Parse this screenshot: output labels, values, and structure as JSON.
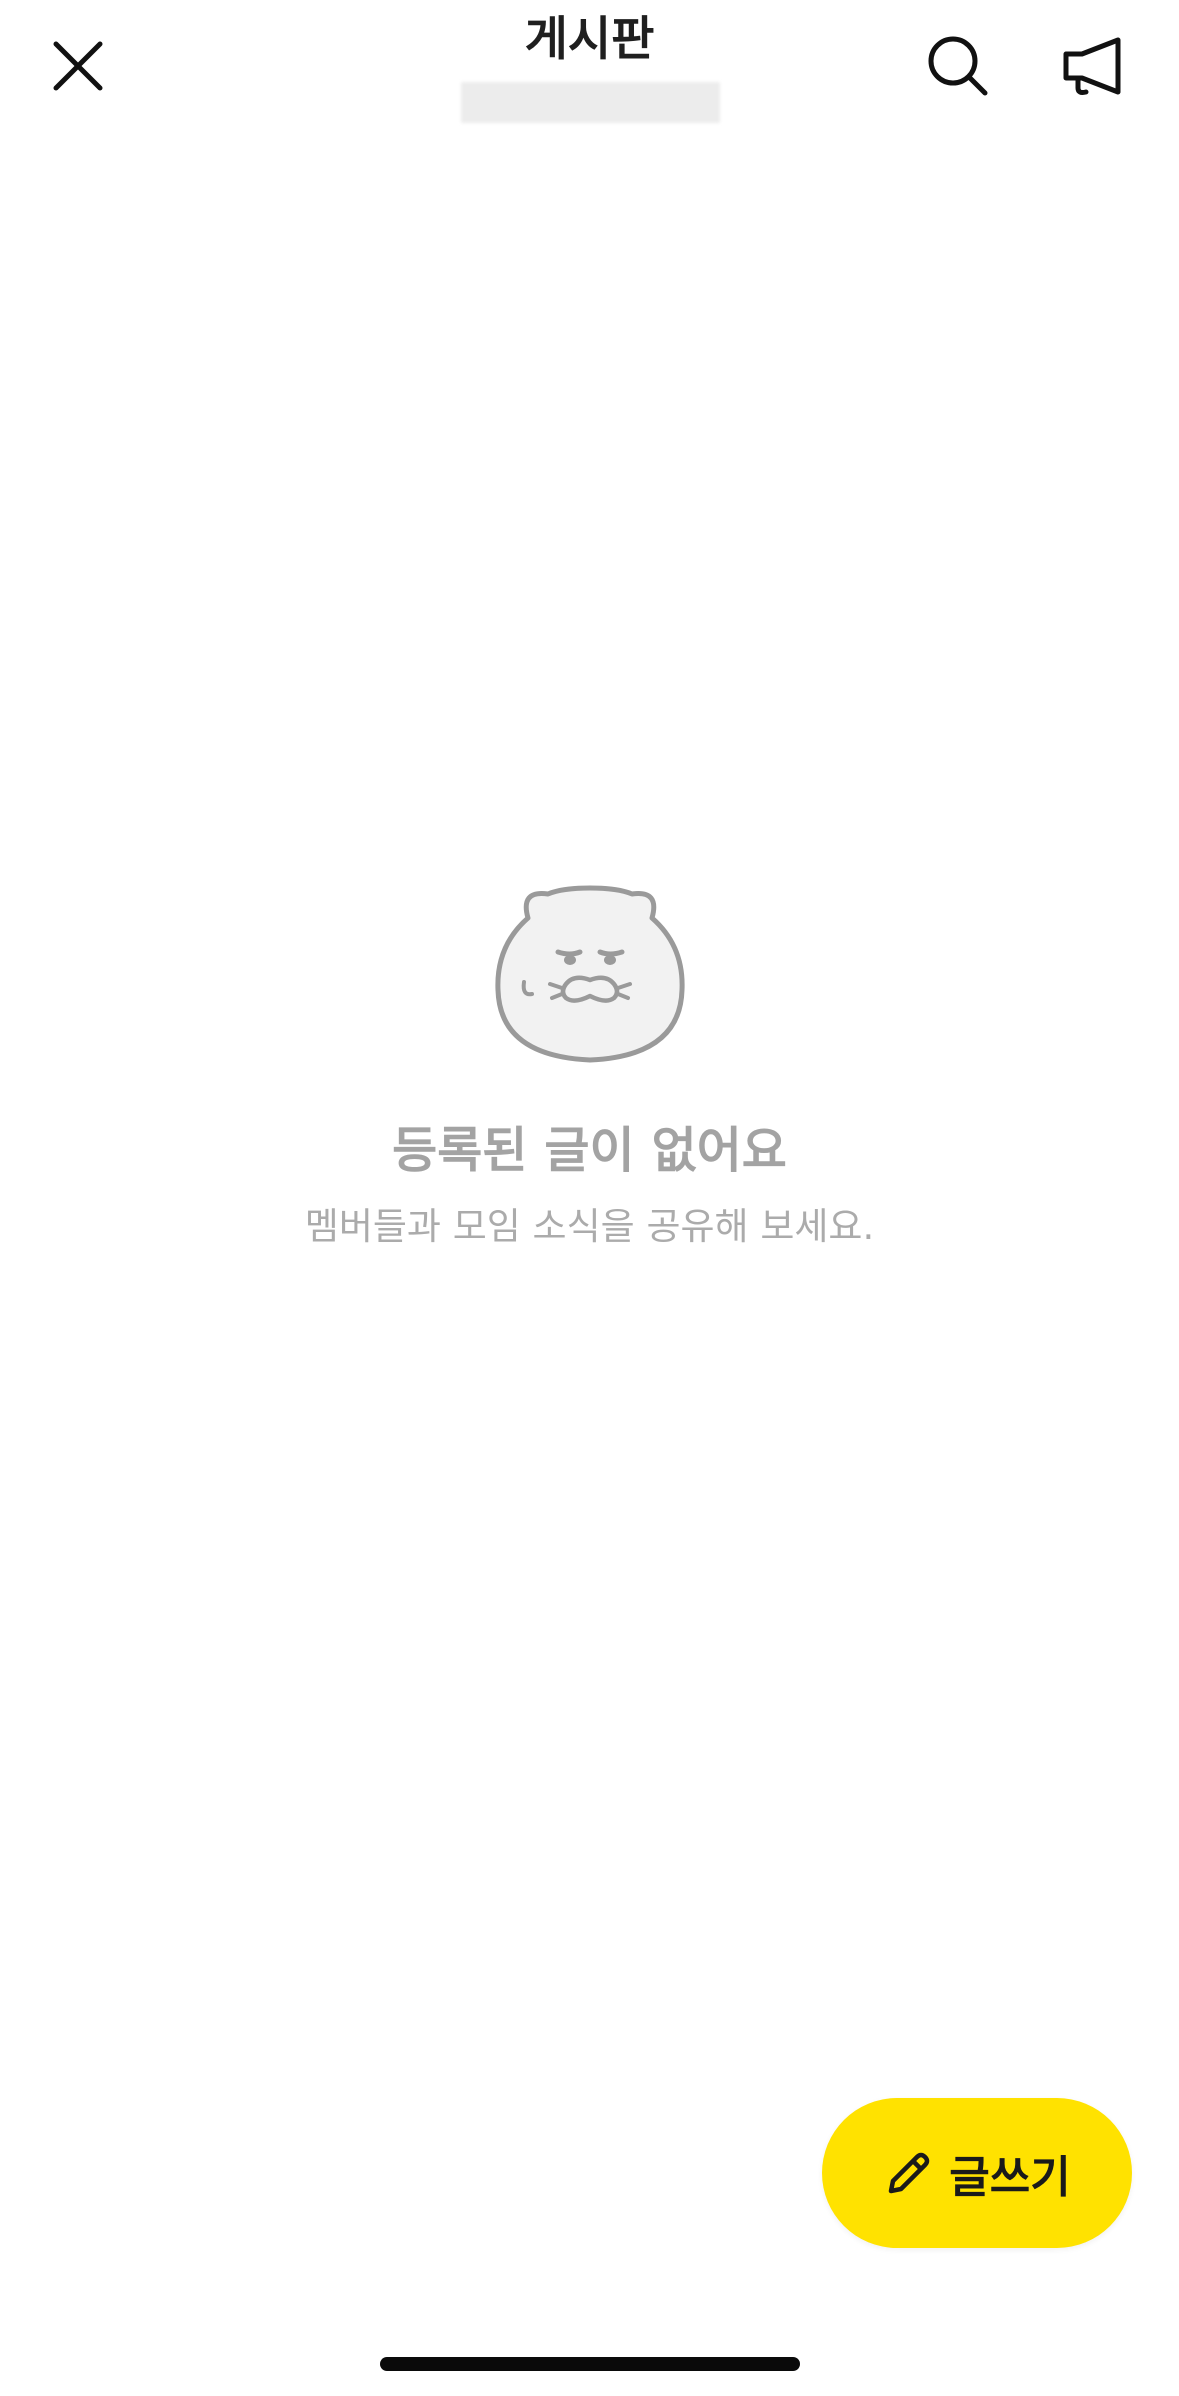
{
  "header": {
    "title": "게시판",
    "icons": {
      "close": "close-icon",
      "search": "search-icon",
      "notice": "megaphone-icon"
    }
  },
  "empty_state": {
    "mascot": "bear-face-icon",
    "title": "등록된 글이 없어요",
    "description": "멤버들과 모임 소식을 공유해 보세요."
  },
  "fab": {
    "label": "글쓰기",
    "icon": "pencil-icon",
    "color": "#ffe200"
  },
  "colors": {
    "background": "#ffffff",
    "empty_text": "#a3a3a3",
    "accent": "#ffe200"
  }
}
